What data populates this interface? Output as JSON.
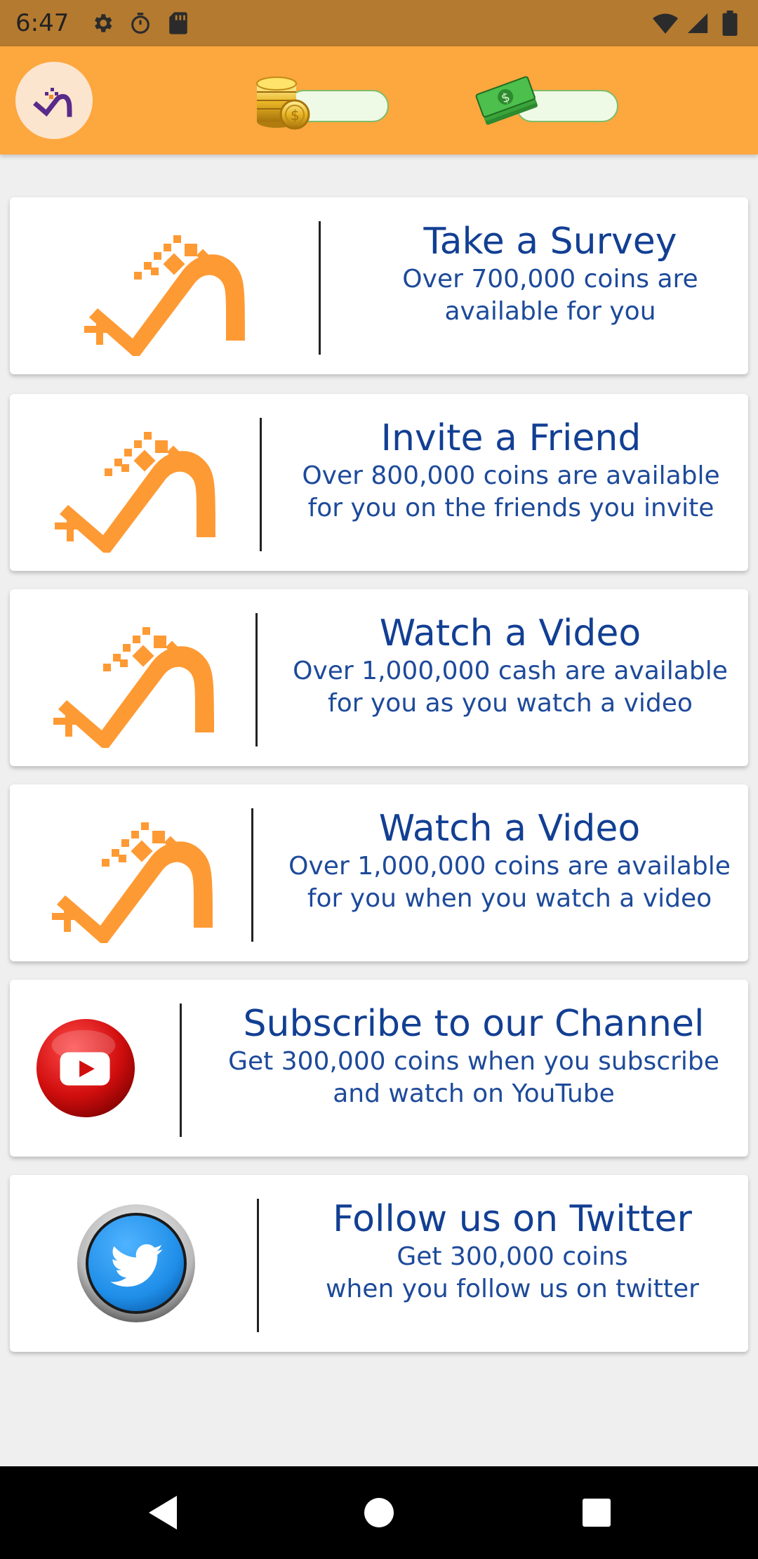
{
  "status_bar": {
    "time": "6:47",
    "left_icons": [
      "gear-icon",
      "stopwatch-icon",
      "sd-card-icon"
    ],
    "right_icons": [
      "wifi-icon",
      "cell-signal-icon",
      "battery-icon"
    ]
  },
  "app_bar": {
    "logo_icon": "app-logo-icon",
    "coins_balance": "",
    "cash_balance": "",
    "colors": {
      "bar": "#fda73f",
      "logo_bg": "#fce5cf"
    }
  },
  "cards": [
    {
      "title": "Take a Survey",
      "line1": "Over 700,000 coins are",
      "line2": "available for you",
      "icon": "app-logo-icon"
    },
    {
      "title": "Invite a Friend",
      "line1": "Over 800,000 coins are available",
      "line2": "for you on the friends you invite",
      "icon": "app-logo-icon"
    },
    {
      "title": "Watch a Video",
      "line1": "Over 1,000,000 cash are available",
      "line2": "for you as you watch a video",
      "icon": "app-logo-icon"
    },
    {
      "title": "Watch a Video",
      "line1": "Over 1,000,000 coins are available",
      "line2": "for you when you watch a video",
      "icon": "app-logo-icon"
    },
    {
      "title": "Subscribe to our Channel",
      "line1": "Get 300,000 coins when you subscribe",
      "line2": "and watch on YouTube",
      "icon": "youtube-icon"
    },
    {
      "title": "Follow us on Twitter",
      "line1": "Get 300,000 coins",
      "line2": "when you follow us on twitter",
      "icon": "twitter-icon"
    }
  ],
  "nav_bar": {
    "buttons": [
      "back-icon",
      "home-icon",
      "recents-icon"
    ]
  },
  "colors": {
    "accent_orange": "#fe9a34",
    "title_blue": "#123f93",
    "text_blue": "#1d4a9a",
    "status_bar": "#b47a30"
  }
}
